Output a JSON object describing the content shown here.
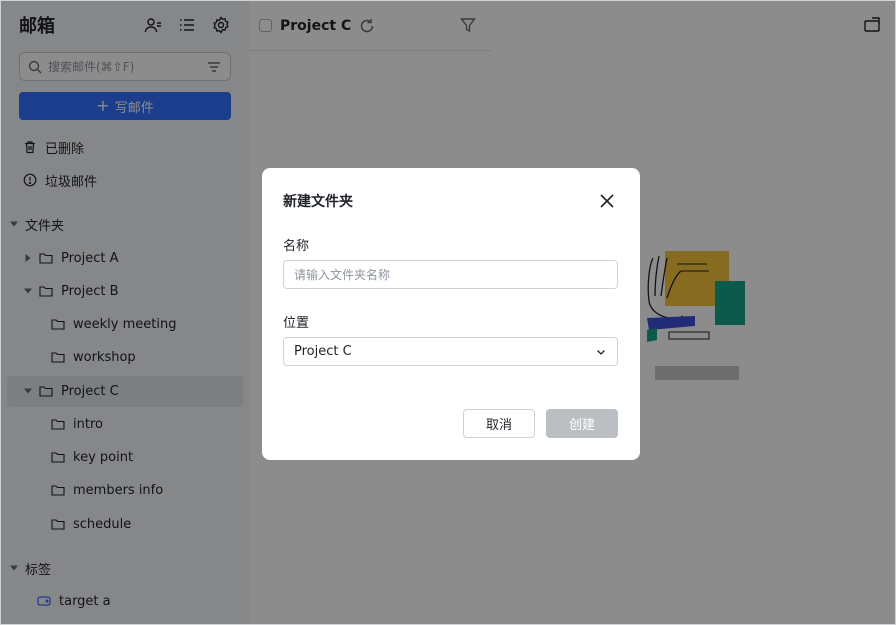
{
  "sidebar": {
    "title": "邮箱",
    "header_icons": [
      "contact-icon",
      "list-icon",
      "settings-icon"
    ],
    "search": {
      "placeholder": "搜索邮件(⌘⇧F)"
    },
    "compose_label": "写邮件",
    "nav": [
      {
        "label": "已删除",
        "icon": "trash-icon"
      },
      {
        "label": "垃圾邮件",
        "icon": "spam-icon"
      }
    ],
    "folders_section": "文件夹",
    "folders": {
      "project_a": "Project A",
      "project_b": "Project B",
      "weekly_meeting": "weekly meeting",
      "workshop": "workshop",
      "project_c": "Project C",
      "intro": "intro",
      "key_point": "key point",
      "members_info": "members info",
      "schedule": "schedule"
    },
    "tags_section": "标签",
    "tags": [
      {
        "label": "target a",
        "color": "#3370ff"
      }
    ]
  },
  "list": {
    "title": "Project C"
  },
  "dialog": {
    "title": "新建文件夹",
    "name_label": "名称",
    "name_placeholder": "请输入文件夹名称",
    "name_value": "",
    "location_label": "位置",
    "location_value": "Project C",
    "cancel_label": "取消",
    "create_label": "创建"
  },
  "colors": {
    "accent": "#3370ff",
    "overlay": "rgba(0,0,0,0.45)",
    "disabled_button": "#bbbfc4"
  }
}
